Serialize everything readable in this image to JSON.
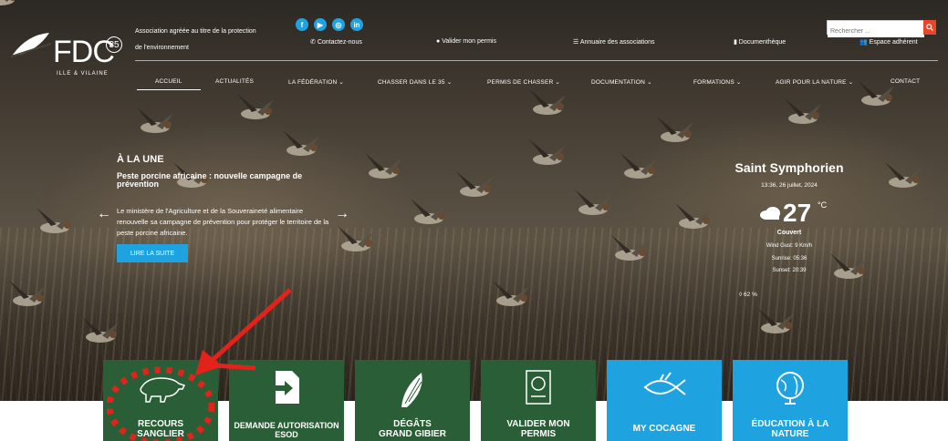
{
  "header": {
    "logo_text": "FDC",
    "logo_number": "35",
    "logo_subtitle": "ILLE & VILAINE",
    "association_text": "Association agréée au titre de la protection de l'environnement",
    "top_links": [
      "Contactez-nous",
      "Valider mon permis",
      "Annuaire des associations",
      "Documenthèque",
      "Espace adhérent"
    ],
    "search_placeholder": "Rechercher ..."
  },
  "nav": {
    "items": [
      "ACCUEIL",
      "ACTUALITÉS",
      "LA FÉDÉRATION",
      "CHASSER DANS LE 35",
      "PERMIS DE CHASSER",
      "DOCUMENTATION",
      "FORMATIONS",
      "AGIR POUR LA NATURE",
      "CONTACT"
    ],
    "active": "ACCUEIL"
  },
  "une": {
    "label": "À LA UNE",
    "headline": "Peste porcine africaine : nouvelle campagne de prévention",
    "text": "Le ministère de l'Agriculture et de la Souveraineté alimentaire renouvelle sa campagne de prévention pour protéger le territoire de la peste porcine africaine.",
    "button": "LIRE LA SUITE"
  },
  "weather": {
    "city": "Saint Symphorien",
    "datetime": "13:36, 26 juillet, 2024",
    "temperature": "27",
    "unit": "°C",
    "condition": "Couvert",
    "wind": "Wind Gust: 9 Km/h",
    "sunrise": "Sunrise: 05:36",
    "sunset": "Sunset: 20:39",
    "humidity": "62 %"
  },
  "tiles": [
    {
      "l1": "RECOURS",
      "l2": "SANGLIER",
      "color": "#295e36",
      "icon": "boar-icon"
    },
    {
      "l1": "DEMANDE AUTORISATION",
      "l2": "ESOD",
      "color": "#295e36",
      "icon": "document-arrow-icon"
    },
    {
      "l1": "DÉGÂTS",
      "l2": "GRAND GIBIER",
      "color": "#295e36",
      "icon": "corn-icon"
    },
    {
      "l1": "VALIDER MON",
      "l2": "PERMIS",
      "color": "#295e36",
      "icon": "permit-document-icon"
    },
    {
      "l1": "MY COCAGNE",
      "l2": "",
      "color": "#1fa3e0",
      "icon": "fish-icon"
    },
    {
      "l1": "ÉDUCATION À LA",
      "l2": "NATURE",
      "color": "#1fa3e0",
      "icon": "globe-icon"
    }
  ],
  "colors": {
    "accent_blue": "#1fa3e0",
    "tile_green": "#295e36",
    "annotation_red": "#e3231b",
    "search_button": "#e8452b"
  }
}
